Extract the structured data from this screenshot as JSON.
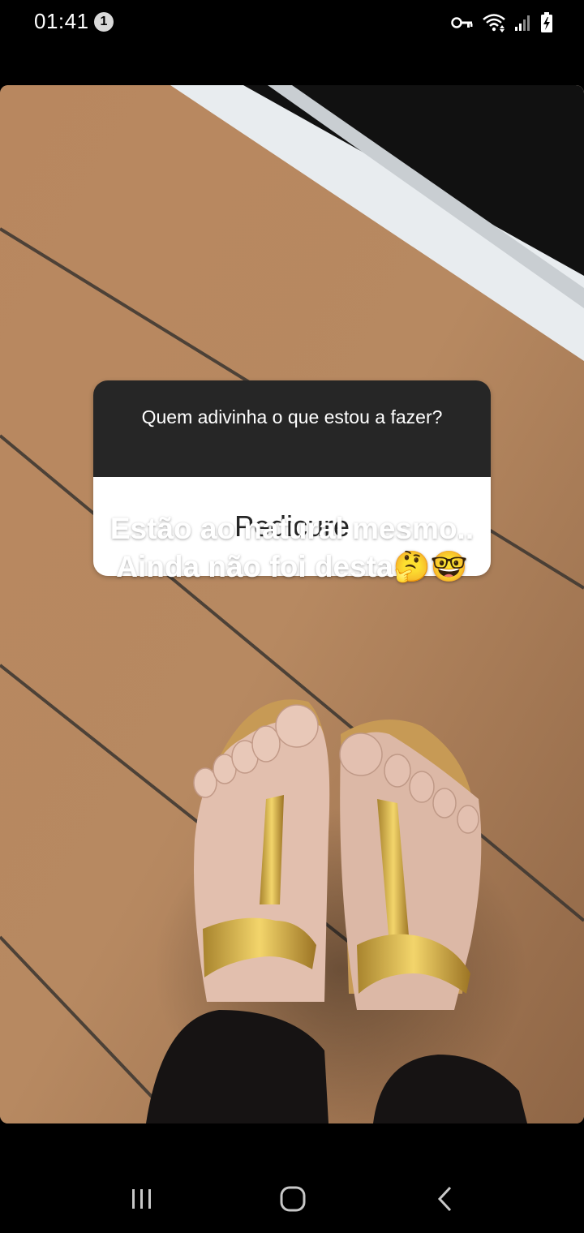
{
  "status_bar": {
    "time": "01:41",
    "notification_count": "1",
    "icons": [
      "vpn-key-icon",
      "wifi-icon",
      "signal-icon",
      "battery-charging-icon"
    ]
  },
  "story": {
    "question_sticker": {
      "question": "Quem adivinha o que estou a fazer?",
      "answer": "Pedicure"
    },
    "caption": {
      "line1": "Estão ao natural mesmo..",
      "line2": "Ainda não foi desta🤔🤓"
    }
  },
  "nav_bar": {
    "buttons": [
      "recent-apps-icon",
      "home-icon",
      "back-icon"
    ]
  },
  "colors": {
    "background": "#000000",
    "deck_wood": "#b5865f",
    "sticker_header": "#262626",
    "sticker_body": "#ffffff"
  }
}
